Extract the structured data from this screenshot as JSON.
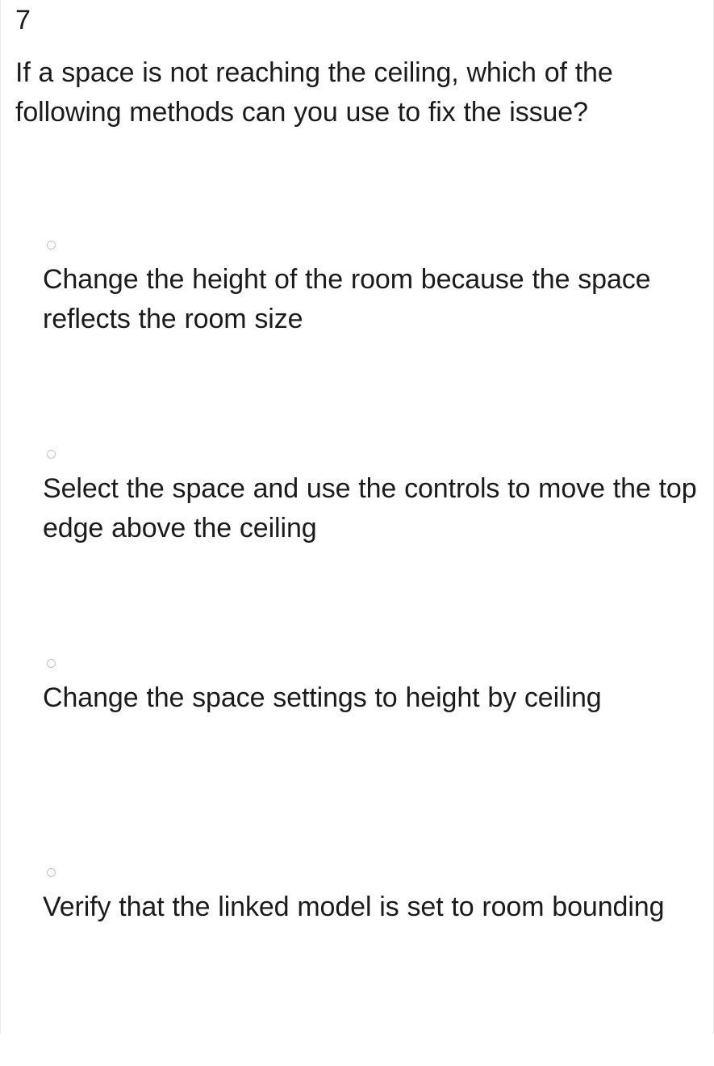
{
  "question": {
    "number": "7",
    "text": "If a space is not reaching the ceiling, which of the following methods can you use to fix the issue?"
  },
  "options": [
    {
      "id": "option-a",
      "label": "Change the height of the room because the space reflects the room size",
      "selected": false,
      "radio_icon": "radio-unchecked-icon"
    },
    {
      "id": "option-b",
      "label": "Select the space and use the controls to move the top edge above the ceiling",
      "selected": false,
      "radio_icon": "radio-unchecked-icon"
    },
    {
      "id": "option-c",
      "label": "Change the space settings to height by ceiling",
      "selected": false,
      "radio_icon": "radio-unchecked-icon"
    },
    {
      "id": "option-d",
      "label": "Verify that the linked model is set to room bounding",
      "selected": false,
      "radio_icon": "radio-unchecked-icon"
    }
  ],
  "colors": {
    "background": "#ffffff",
    "text": "#1b1b1b",
    "border": "#ebebeb",
    "radio_border": "#c3c3c3"
  }
}
